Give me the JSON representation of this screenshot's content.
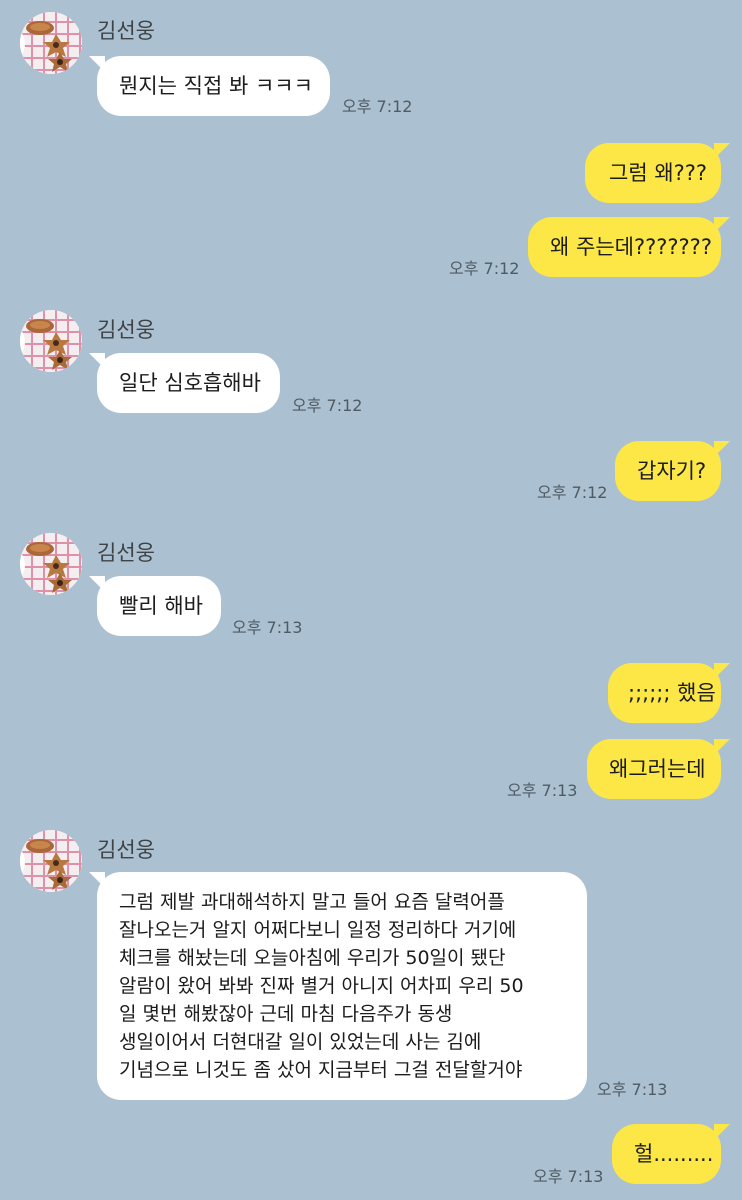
{
  "sender_name": "김선웅",
  "messages": [
    {
      "side": "in",
      "text": "뭔지는 직접 봐 ㅋㅋㅋ",
      "time": "오후 7:12"
    },
    {
      "side": "out",
      "text": "그럼 왜???"
    },
    {
      "side": "out",
      "text": "왜 주는데???????",
      "time": "오후 7:12"
    },
    {
      "side": "in",
      "text": "일단 심호흡해바",
      "time": "오후 7:12"
    },
    {
      "side": "out",
      "text": "갑자기?",
      "time": "오후 7:12"
    },
    {
      "side": "in",
      "text": "빨리 해바",
      "time": "오후 7:13"
    },
    {
      "side": "out",
      "text": ";;;;;; 했음"
    },
    {
      "side": "out",
      "text": "왜그러는데",
      "time": "오후 7:13"
    },
    {
      "side": "in",
      "lines": [
        "그럼 제발 과대해석하지 말고 들어 요즘 달력어플",
        "잘나오는거 알지 어쩌다보니 일정 정리하다 거기에",
        "체크를 해놨는데 오늘아침에 우리가 50일이 됐단",
        "알람이 왔어 봐봐 진짜 별거 아니지 어차피 우리 50",
        "일 몇번 해봤잖아 근데 마침 다음주가 동생",
        "생일이어서 더현대갈 일이 있었는데 사는 김에",
        "기념으로 니것도 좀 샀어 지금부터 그걸 전달할거야"
      ],
      "time": "오후 7:13"
    },
    {
      "side": "out",
      "text": "헐.........",
      "time": "오후 7:13"
    }
  ]
}
